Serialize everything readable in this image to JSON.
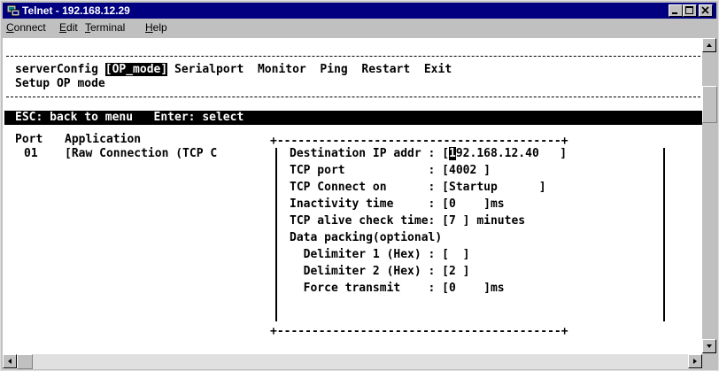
{
  "window": {
    "title": "Telnet - 192.168.12.29"
  },
  "menu": {
    "items": [
      {
        "label": "Connect",
        "accel": "C",
        "rest": "onnect"
      },
      {
        "label": "Edit",
        "accel": "E",
        "rest": "dit"
      },
      {
        "label": "Terminal",
        "accel": "T",
        "rest": "erminal"
      },
      {
        "label": "Help",
        "accel": "H",
        "rest": "elp"
      }
    ]
  },
  "terminal": {
    "top_menu": {
      "server_config": "serverConfig",
      "op_mode_selected": "[OP_mode]",
      "serialport": "Serialport",
      "monitor": "Monitor",
      "ping": "Ping",
      "restart": "Restart",
      "exit": "Exit"
    },
    "subtitle": "Setup OP mode",
    "status_bar": "ESC: back to menu   Enter: select",
    "table": {
      "header_port": "Port",
      "header_application": "Application",
      "port": "01",
      "application": "[Raw Connection (TCP C"
    },
    "dialog": {
      "top_border": "+-----------------------------------------+",
      "bottom_border": "+-----------------------------------------+",
      "destination_ip_label": "Destination IP addr :",
      "destination_ip_open": "[",
      "destination_ip_cursor": "1",
      "destination_ip_rest": "92.168.12.40   ]",
      "tcp_port": "TCP port            : [4002 ]",
      "tcp_connect_on": "TCP Connect on      : [Startup      ]",
      "inactivity_time": "Inactivity time     : [0    ]ms",
      "tcp_alive": "TCP alive check time: [7 ] minutes",
      "data_packing": "Data packing(optional)",
      "delimiter1": "  Delimiter 1 (Hex) : [  ]",
      "delimiter2": "  Delimiter 2 (Hex) : [2 ]",
      "force_transmit": "  Force transmit    : [0    ]ms"
    }
  },
  "colors": {
    "titlebar": "#000080",
    "window": "#c0c0c0",
    "terminal_bg": "#ffffff",
    "terminal_fg": "#000000"
  }
}
